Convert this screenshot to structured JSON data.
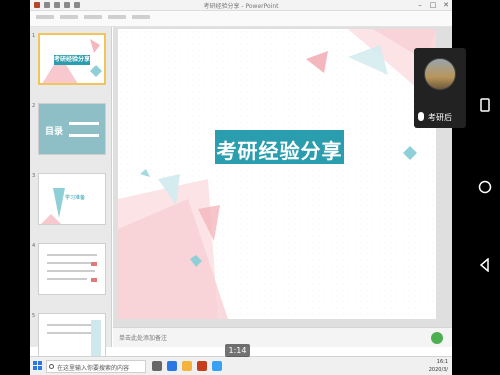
{
  "window": {
    "title": "考研经验分享 - PowerPoint",
    "minimize": "–",
    "maximize": "□",
    "close": "✕"
  },
  "slides_pane": {
    "thumbnails": [
      {
        "number": "1",
        "title": "考研经验分享"
      },
      {
        "number": "2",
        "title": "目录"
      },
      {
        "number": "3",
        "title": "学习准备"
      },
      {
        "number": "4",
        "title": ""
      },
      {
        "number": "5",
        "title": ""
      }
    ]
  },
  "slide": {
    "title": "考研经验分享",
    "accent": "#2a9daf"
  },
  "notes": {
    "placeholder": "单击此处添加备注"
  },
  "taskbar": {
    "search_placeholder": "在这里输入你要搜索的内容",
    "clock_time": "16:1",
    "clock_date": "2020/3/"
  },
  "video": {
    "timestamp": "1:14",
    "participant_name": "考研后"
  },
  "colors": {
    "pink": "#f3b7bd",
    "teal": "#8fd0d8",
    "dark_teal": "#2a9daf"
  }
}
